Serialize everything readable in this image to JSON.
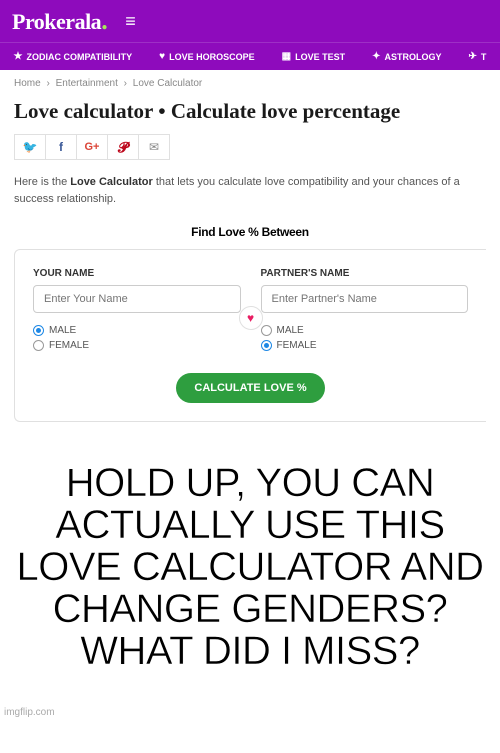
{
  "header": {
    "logo": "Prokerala"
  },
  "nav": {
    "items": [
      {
        "icon": "★",
        "label": "ZODIAC COMPATIBILITY"
      },
      {
        "icon": "♥",
        "label": "LOVE HOROSCOPE"
      },
      {
        "icon": "▦",
        "label": "LOVE TEST"
      },
      {
        "icon": "✦",
        "label": "ASTROLOGY"
      },
      {
        "icon": "✈",
        "label": "T"
      }
    ]
  },
  "breadcrumb": {
    "home": "Home",
    "entertainment": "Entertainment",
    "current": "Love Calculator"
  },
  "title": "Love calculator • Calculate love percentage",
  "intro": {
    "pre": "Here is the ",
    "bold": "Love Calculator",
    "post": " that lets you calculate love compatibility and your chances of a success relationship."
  },
  "find_love": "Find Love % Between",
  "form": {
    "your_label": "YOUR NAME",
    "your_placeholder": "Enter Your Name",
    "partner_label": "PARTNER'S NAME",
    "partner_placeholder": "Enter Partner's Name",
    "male": "MALE",
    "female": "FEMALE",
    "heart": "♥",
    "button": "CALCULATE LOVE %"
  },
  "meme": "HOLD UP, YOU CAN ACTUALLY USE THIS LOVE CALCULATOR AND CHANGE GENDERS? WHAT DID I MISS?",
  "watermark": "imgflip.com"
}
